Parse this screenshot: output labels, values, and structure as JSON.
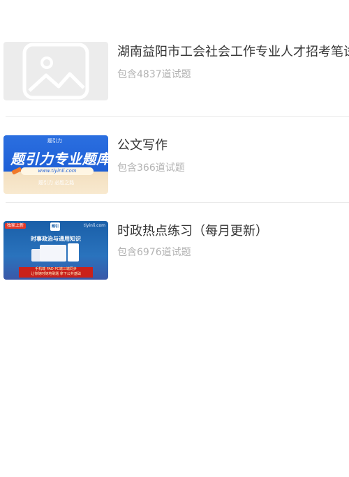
{
  "list": {
    "items": [
      {
        "title": "湖南益阳市工会社会工作专业人才招考笔试",
        "subtitle": "包含4837道试题",
        "thumbnail": "image-placeholder-icon"
      },
      {
        "title": "公文写作",
        "subtitle": "包含366道试题",
        "thumbnail": {
          "brand": "题引力",
          "headline": "题引力专业题库",
          "url": "www.tiyinli.com",
          "tagline": "题引力 必胜之路"
        }
      },
      {
        "title": "时政热点练习（每月更新）",
        "subtitle": "包含6976道试题",
        "thumbnail": {
          "badge": "独家上新",
          "site": "tiyinli.com",
          "logo": "题引力",
          "headline": "时事政治与通用知识",
          "banner_line1": "手机端 PAD PC端三端同步",
          "banner_line2": "让你随时随地刷题  拿下公共基础"
        }
      }
    ]
  },
  "colors": {
    "title": "#333333",
    "subtitle": "#b3b3b3",
    "divider": "#e9e9e9",
    "placeholder_bg": "#ececec"
  }
}
